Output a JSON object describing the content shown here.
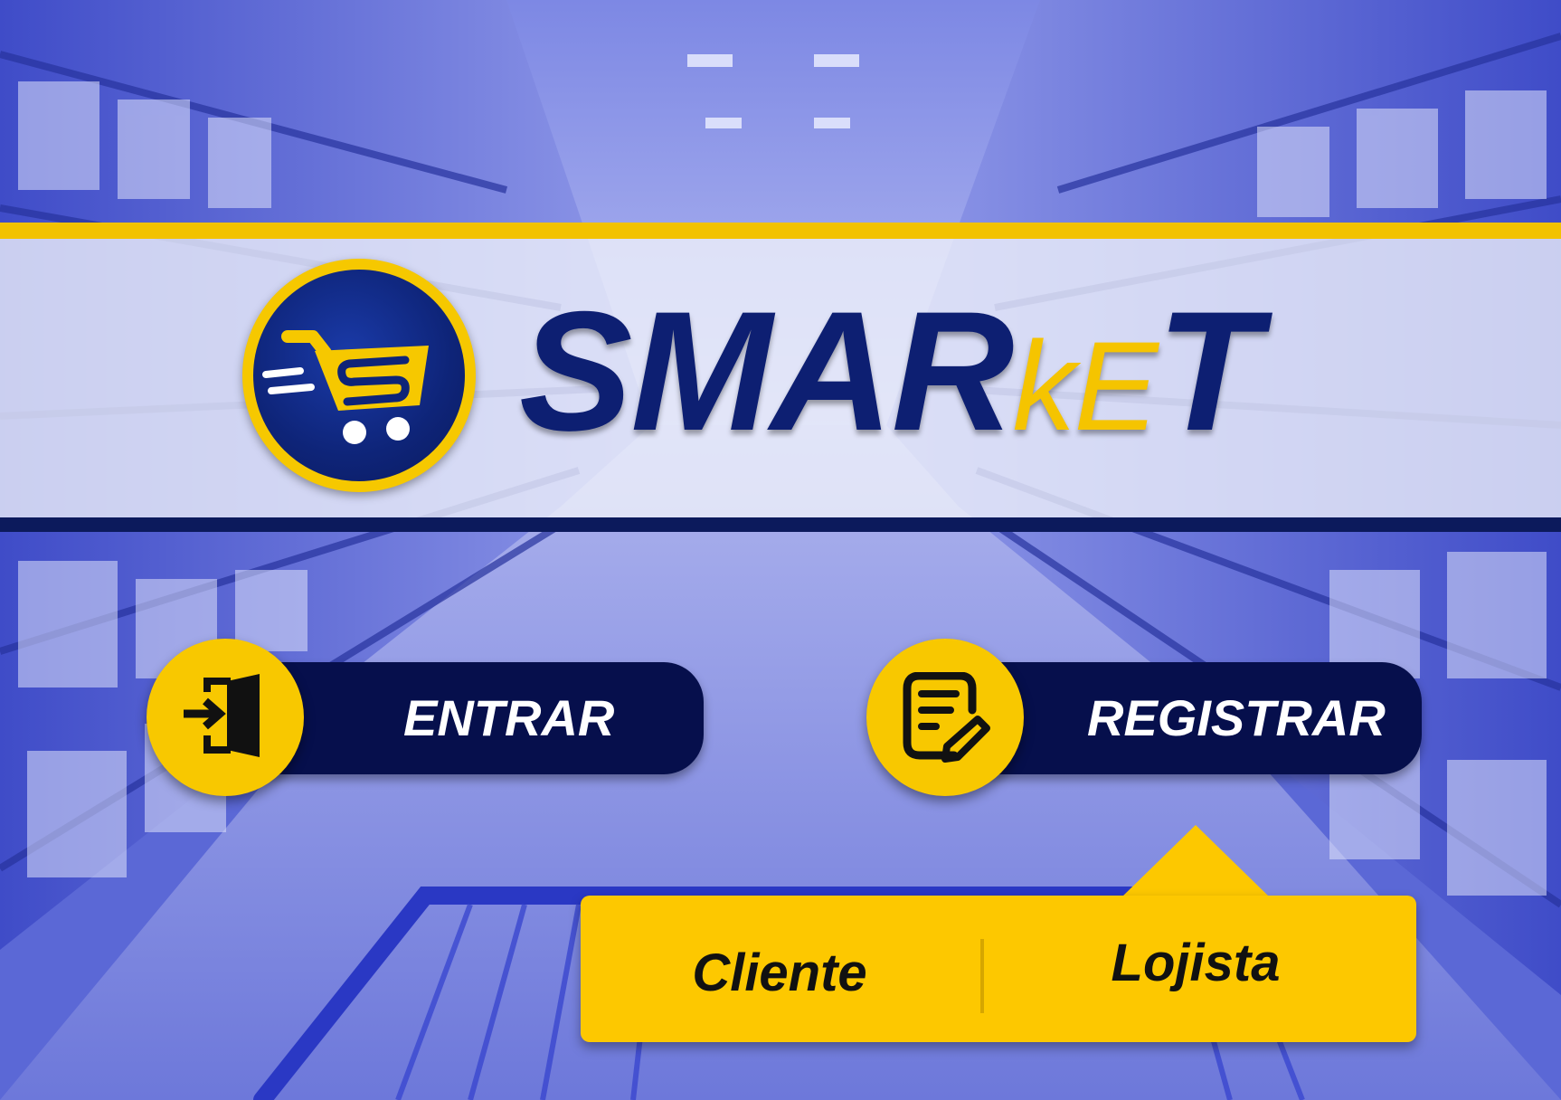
{
  "brand": {
    "name_part1": "SMAR",
    "name_part2": "kE",
    "name_part3": "T"
  },
  "actions": {
    "entrar_label": "ENTRAR",
    "registrar_label": "REGISTRAR"
  },
  "register_menu": {
    "options": [
      {
        "label": "Cliente"
      },
      {
        "label": "Lojista"
      }
    ]
  },
  "icons": {
    "logo": "shopping-cart-icon",
    "entrar": "door-enter-icon",
    "registrar": "form-edit-icon"
  },
  "colors": {
    "navy": "#060f4c",
    "brand_navy": "#0d1f72",
    "gold": "#f8c800",
    "background_blue": "#5b68d6"
  }
}
